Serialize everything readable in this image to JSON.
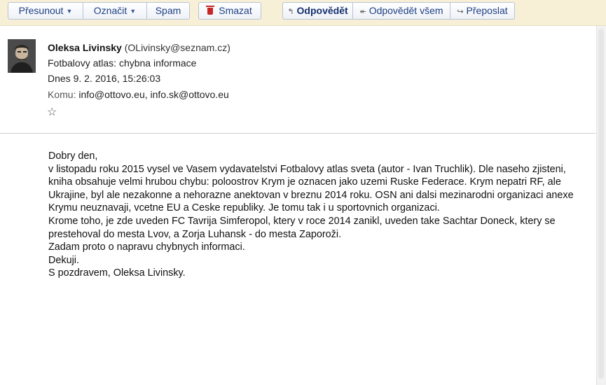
{
  "toolbar": {
    "move_label": "Přesunout",
    "mark_label": "Označit",
    "spam_label": "Spam",
    "delete_label": "Smazat",
    "reply_label": "Odpovědět",
    "reply_all_label": "Odpovědět všem",
    "forward_label": "Přeposlat"
  },
  "message": {
    "sender_name": "Oleksa Livinsky",
    "sender_email": "(OLivinsky@seznam.cz)",
    "subject": "Fotbalovy atlas: chybna informace",
    "date": "Dnes 9. 2. 2016, 15:26:03",
    "to_label": "Komu:",
    "to_value": "info@ottovo.eu, info.sk@ottovo.eu",
    "star": "☆",
    "body_lines": [
      "Dobry den,",
      "v listopadu roku 2015 vysel ve Vasem vydavatelstvi Fotbalovy atlas sveta (autor - Ivan Truchlik). Dle naseho zjisteni,",
      "kniha obsahuje velmi hrubou chybu: poloostrov Krym je oznacen jako uzemi Ruske Federace. Krym nepatri RF, ale",
      "Ukrajine, byl ale nezakonne a nehorazne anektovan v breznu 2014 roku. OSN ani dalsi mezinarodni organizaci anexe",
      "Krymu neuznavaji, vcetne EU a Ceske republiky. Je tomu tak i u sportovnich organizaci.",
      "Krome toho, je zde uveden FC Tavrija Simferopol, ktery v roce 2014 zanikl, uveden take Sachtar Doneck, ktery se",
      "prestehoval do mesta Lvov, a Zorja Luhansk - do mesta Zaporoži.",
      "Zadam proto o napravu chybnych informaci.",
      "Dekuji.",
      "S pozdravem, Oleksa Livinsky."
    ]
  }
}
